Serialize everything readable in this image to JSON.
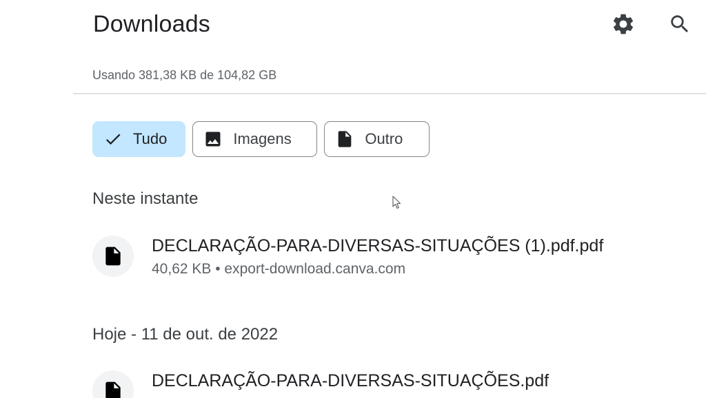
{
  "header": {
    "title": "Downloads",
    "settings_icon": "gear-icon",
    "search_icon": "search-icon"
  },
  "storage": {
    "usage_text": "Usando 381,38 KB de 104,82 GB"
  },
  "filters": [
    {
      "label": "Tudo",
      "icon": "check-icon",
      "selected": true
    },
    {
      "label": "Imagens",
      "icon": "image-icon",
      "selected": false
    },
    {
      "label": "Outro",
      "icon": "document-icon",
      "selected": false
    }
  ],
  "sections": [
    {
      "header": "Neste instante",
      "items": [
        {
          "name": "DECLARAÇÃO-PARA-DIVERSAS-SITUAÇÕES (1).pdf.pdf",
          "meta": "40,62 KB • export-download.canva.com",
          "icon": "file-icon"
        }
      ]
    },
    {
      "header": "Hoje - 11 de out. de 2022",
      "items": [
        {
          "name": "DECLARAÇÃO-PARA-DIVERSAS-SITUAÇÕES.pdf",
          "meta": "",
          "icon": "file-icon"
        }
      ]
    }
  ],
  "colors": {
    "selected_chip_bg": "#c2e7ff",
    "text_primary": "#202124",
    "text_secondary": "#5f6368",
    "divider": "#e0e0e0",
    "icon_bg": "#f1f3f4"
  }
}
